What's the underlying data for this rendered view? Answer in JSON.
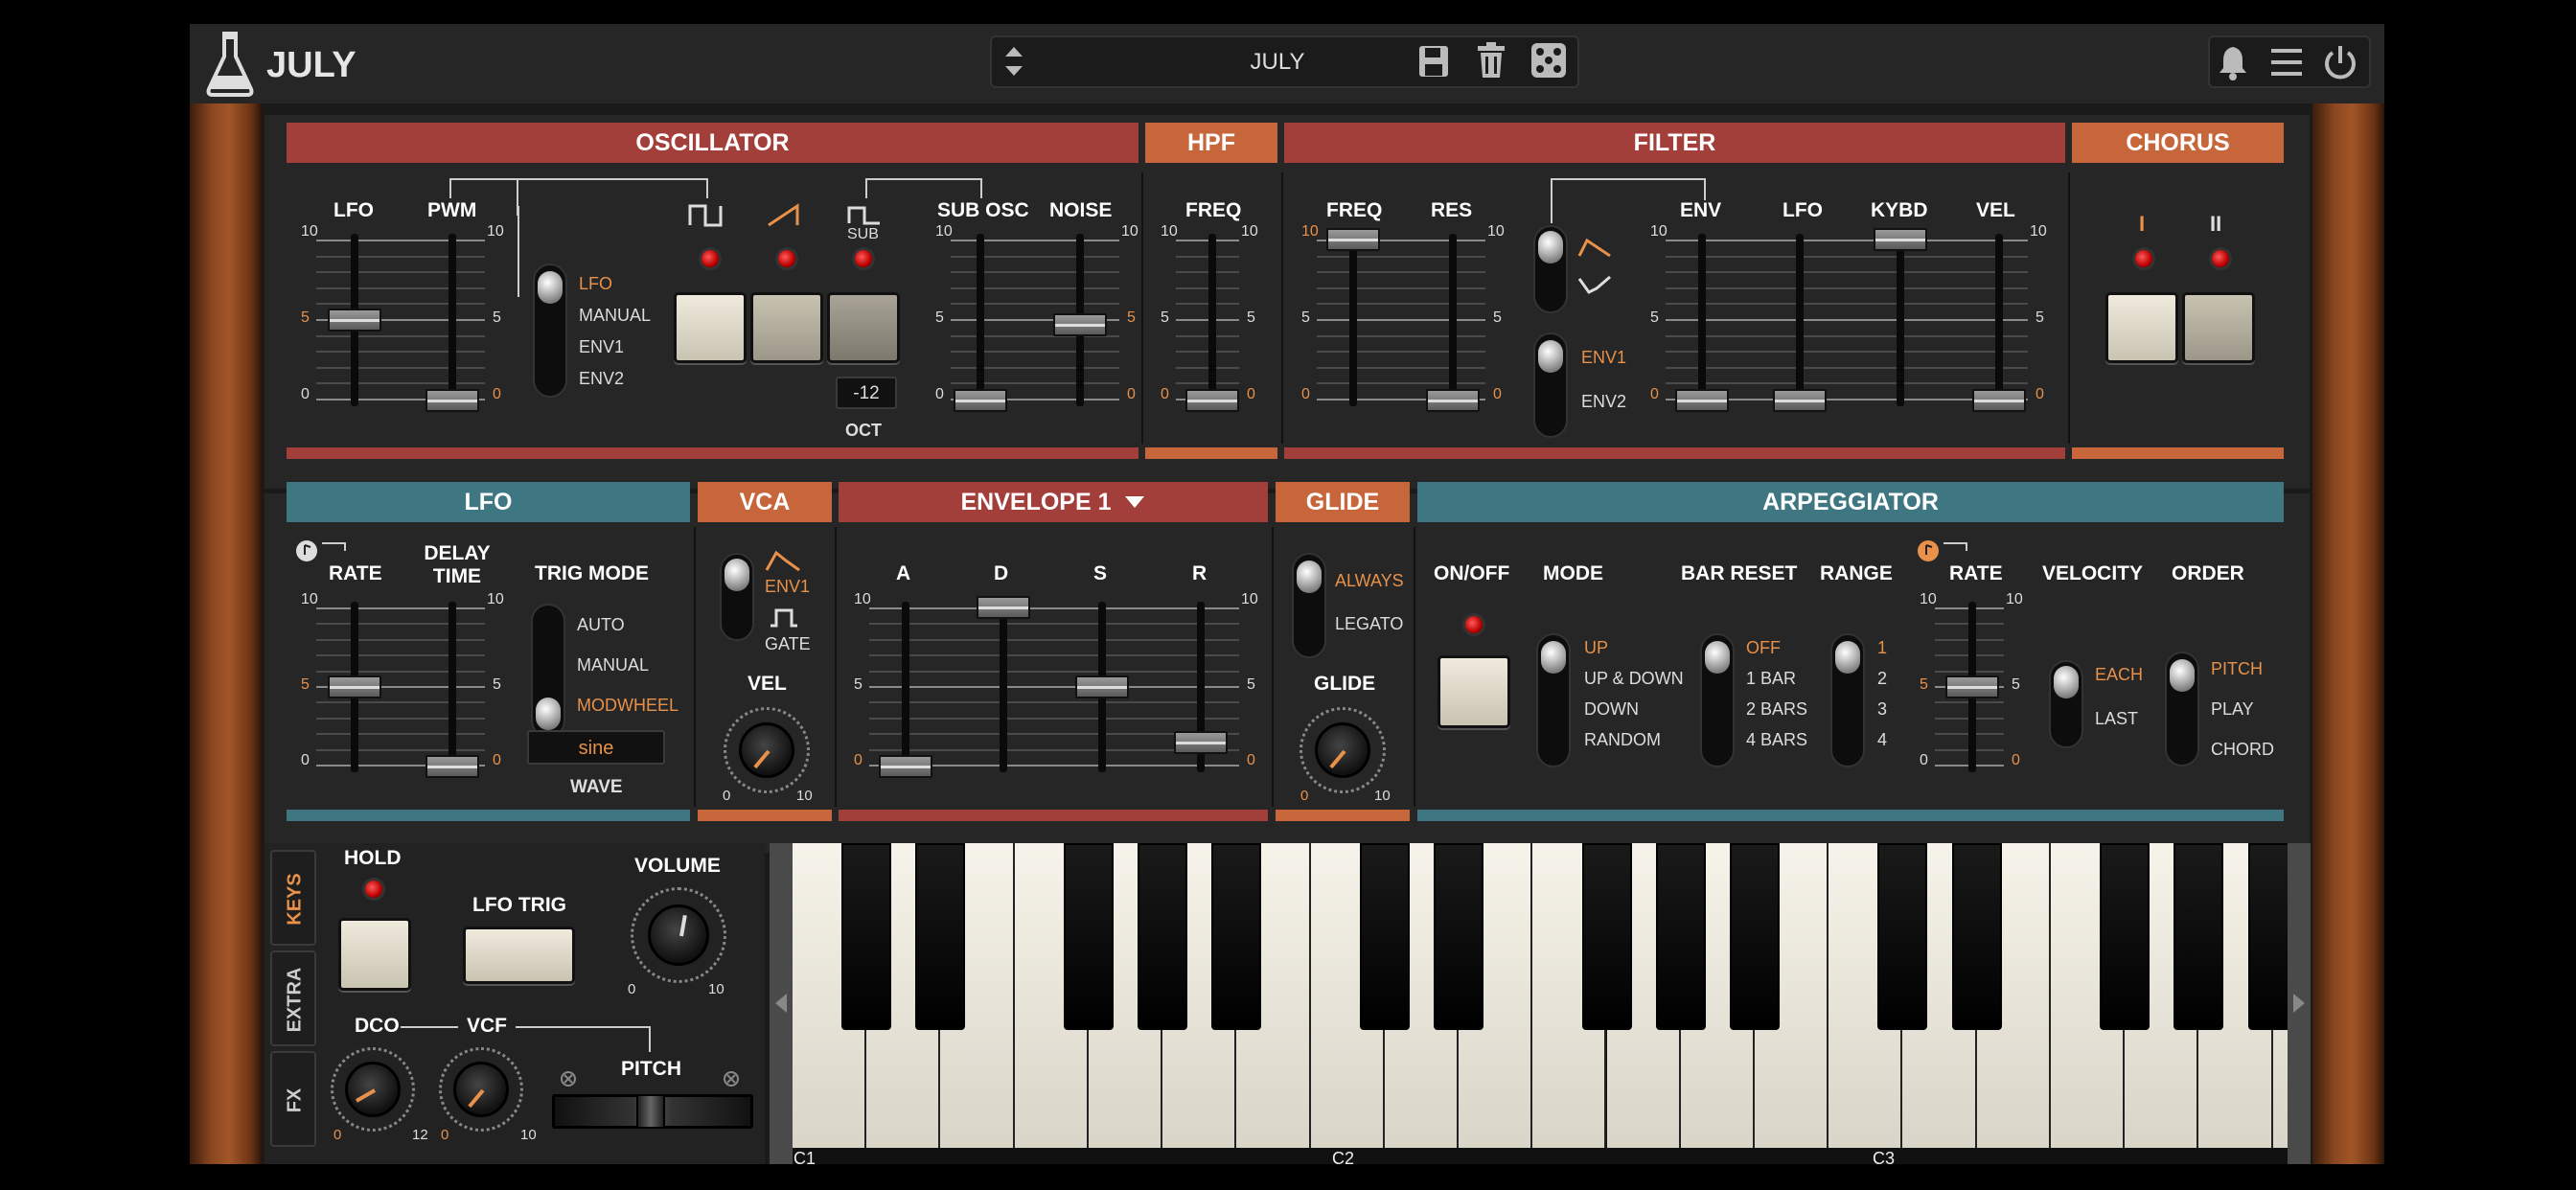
{
  "app": {
    "title": "JULY"
  },
  "preset": {
    "name": "JULY"
  },
  "colors": {
    "red": "#a33f3b",
    "orange": "#c6663a",
    "teal": "#3e7682",
    "accent": "#e8914a"
  },
  "sections": {
    "oscillator": "OSCILLATOR",
    "hpf": "HPF",
    "filter": "FILTER",
    "chorus": "CHORUS",
    "lfo": "LFO",
    "vca": "VCA",
    "envelope": "ENVELOPE 1",
    "glide": "GLIDE",
    "arp": "ARPEGGIATOR"
  },
  "osc": {
    "lfo": "LFO",
    "pwm": "PWM",
    "sub_osc": "SUB OSC",
    "noise": "NOISE",
    "sub": "SUB",
    "pwm_sources": [
      "LFO",
      "MANUAL",
      "ENV1",
      "ENV2"
    ],
    "oct_value": "-12",
    "oct_label": "OCT"
  },
  "hpf": {
    "freq": "FREQ"
  },
  "filter": {
    "freq": "FREQ",
    "res": "RES",
    "env": "ENV",
    "lfo": "LFO",
    "kybd": "KYBD",
    "vel": "VEL",
    "env1": "ENV1",
    "env2": "ENV2"
  },
  "chorus": {
    "i": "I",
    "ii": "II"
  },
  "lfo": {
    "rate": "RATE",
    "delay_time": "DELAY TIME",
    "trig_mode": "TRIG MODE",
    "trig_options": [
      "AUTO",
      "MANUAL",
      "MODWHEEL"
    ],
    "wave_value": "sine",
    "wave_label": "WAVE"
  },
  "vca": {
    "env1": "ENV1",
    "gate": "GATE",
    "vel": "VEL"
  },
  "env": {
    "a": "A",
    "d": "D",
    "s": "S",
    "r": "R"
  },
  "glide": {
    "always": "ALWAYS",
    "legato": "LEGATO",
    "glide": "GLIDE"
  },
  "arp": {
    "onoff": "ON/OFF",
    "mode": "MODE",
    "bar_reset": "BAR RESET",
    "range": "RANGE",
    "rate": "RATE",
    "velocity": "VELOCITY",
    "order": "ORDER",
    "modes": [
      "UP",
      "UP & DOWN",
      "DOWN",
      "RANDOM"
    ],
    "bar_resets": [
      "OFF",
      "1 BAR",
      "2 BARS",
      "4 BARS"
    ],
    "ranges": [
      "1",
      "2",
      "3",
      "4"
    ],
    "velocities": [
      "EACH",
      "LAST"
    ],
    "orders": [
      "PITCH",
      "PLAY",
      "CHORD"
    ]
  },
  "scale": {
    "ten": "10",
    "five": "5",
    "zero": "0",
    "twelve": "12"
  },
  "bottom": {
    "tabs": [
      "KEYS",
      "EXTRA",
      "FX"
    ],
    "hold": "HOLD",
    "lfo_trig": "LFO TRIG",
    "volume": "VOLUME",
    "dco": "DCO",
    "vcf": "VCF",
    "pitch": "PITCH"
  },
  "keyboard": {
    "c1": "C1",
    "c2": "C2",
    "c3": "C3"
  }
}
